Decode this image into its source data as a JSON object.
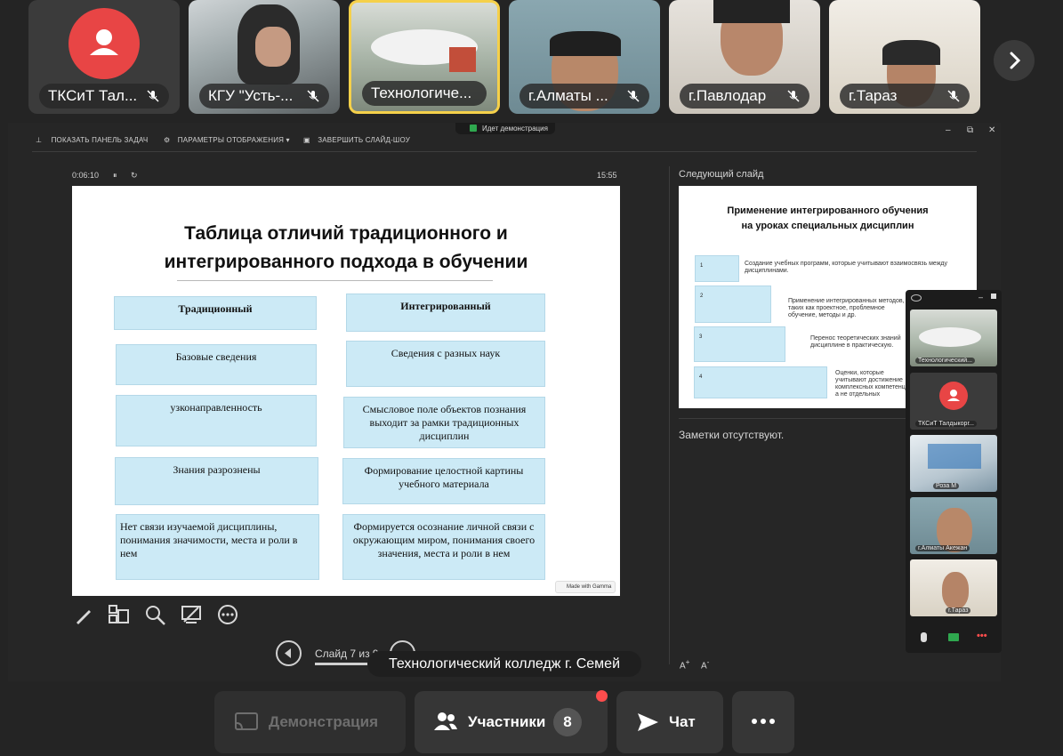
{
  "participants": [
    {
      "name": "ТКСиТ Тал...",
      "muted": true,
      "kind": "avatar"
    },
    {
      "name": "КГУ \"Усть-...",
      "muted": true,
      "kind": "video"
    },
    {
      "name": "Технологиче...",
      "muted": false,
      "kind": "video",
      "active": true
    },
    {
      "name": "г.Алматы ...",
      "muted": true,
      "kind": "video"
    },
    {
      "name": "г.Павлодар",
      "muted": true,
      "kind": "video"
    },
    {
      "name": "г.Тараз",
      "muted": true,
      "kind": "video"
    }
  ],
  "presenter_toolbar": {
    "show_taskbar": "ПОКАЗАТЬ ПАНЕЛЬ ЗАДАЧ",
    "display_settings": "ПАРАМЕТРЫ ОТОБРАЖЕНИЯ ▾",
    "end_slideshow": "ЗАВЕРШИТЬ СЛАЙД-ШОУ",
    "demo_badge": "Идет демонстрация"
  },
  "timer": {
    "elapsed": "0:06:10",
    "clock": "15:55"
  },
  "slide": {
    "title_line1": "Таблица отличий традиционного и",
    "title_line2": "интегрированного подхода в обучении",
    "col_left_header": "Традиционный",
    "col_right_header": "Интегрированный",
    "rows": [
      {
        "left": "Базовые сведения",
        "right": "Сведения с разных наук"
      },
      {
        "left": "узконаправленность",
        "right": "Смысловое поле объектов познания выходит за рамки традиционных дисциплин"
      },
      {
        "left": "Знания разрознены",
        "right": "Формирование целостной картины учебного материала"
      },
      {
        "left": "Нет связи изучаемой дисциплины, понимания значимости, места и роли  в нем",
        "right": "Формируется осознание личной связи с окружающим миром, понимания своего значения, места и роли в нем"
      }
    ],
    "badge": "Made with Gamma"
  },
  "next_slide": {
    "label": "Следующий слайд",
    "title_line1": "Применение интегрированного обучения",
    "title_line2": "на уроках  специальных дисциплин",
    "items": [
      {
        "num": "1",
        "text": "Создание учебных программ, которые учитывают взаимосвязь между дисциплинами."
      },
      {
        "num": "2",
        "text": "Применение интегрированных методов, таких как проектное, проблемное обучение, методы и др."
      },
      {
        "num": "3",
        "text": "Перенос теоретических знаний дисциплине в практическую."
      },
      {
        "num": "4",
        "text": "Оценки, которые учитывают достижение комплексных компетенций, а не отдельных"
      }
    ]
  },
  "notes": "Заметки отсутствуют.",
  "slide_nav": {
    "label": "Слайд 7 из 9"
  },
  "tooltip": "Технологический колледж г. Семей",
  "float_panel": {
    "tiles": [
      {
        "name": "Технологический..."
      },
      {
        "name": "ТКСиТ Талдыкорг..."
      },
      {
        "name": "Роза М"
      },
      {
        "name": "г.Алматы Акежан"
      },
      {
        "name": "г.Тараз"
      }
    ]
  },
  "controls": {
    "demo": "Демонстрация",
    "participants": "Участники",
    "participants_count": "8",
    "chat": "Чат"
  },
  "colors": {
    "accent": "#f5d04a",
    "avatar_red": "#e84545",
    "cell_blue": "#cceaf6",
    "notification": "#ff4d4d"
  }
}
